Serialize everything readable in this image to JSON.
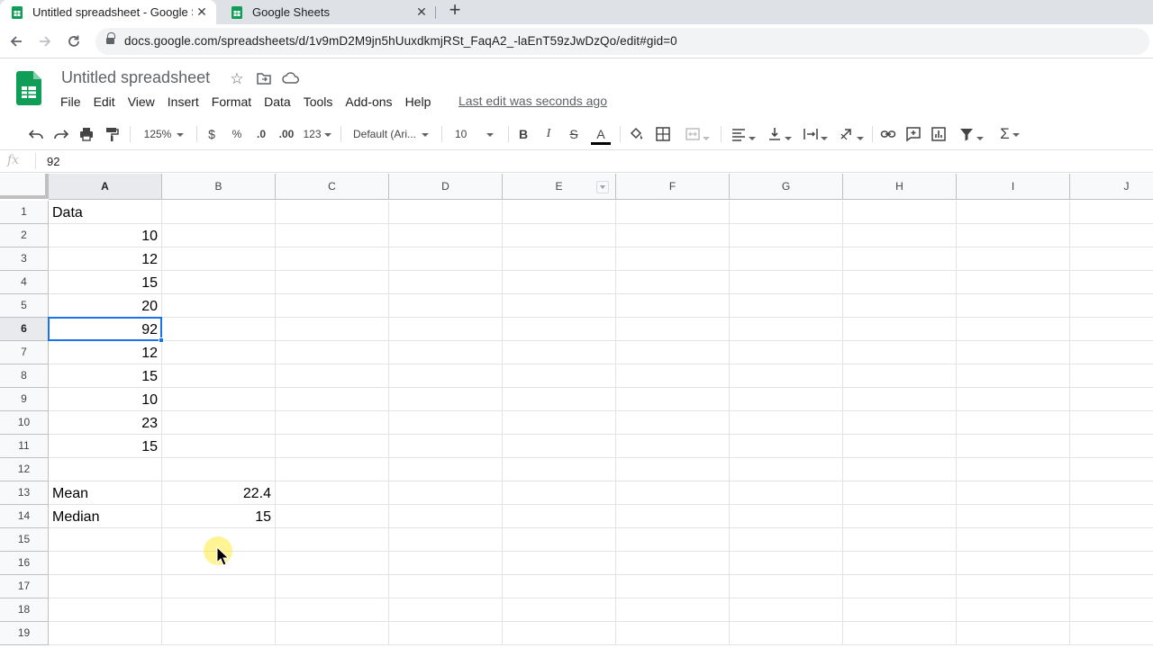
{
  "browser": {
    "tabs": [
      {
        "label": "Untitled spreadsheet - Google Sh",
        "active": true
      },
      {
        "label": "Google Sheets",
        "active": false
      }
    ],
    "url": "docs.google.com/spreadsheets/d/1v9mD2M9jn5hUuxdkmjRSt_FaqA2_-laEnT59zJwDzQo/edit#gid=0"
  },
  "app": {
    "title": "Untitled spreadsheet",
    "menu": [
      "File",
      "Edit",
      "View",
      "Insert",
      "Format",
      "Data",
      "Tools",
      "Add-ons",
      "Help"
    ],
    "last_edit": "Last edit was seconds ago",
    "brand_color": "#0f9d58"
  },
  "toolbar": {
    "zoom": "125%",
    "currency": "$",
    "percent": "%",
    "dec_decrease": ".0",
    "dec_increase": ".00",
    "more_formats": "123",
    "font": "Default (Ari...",
    "font_size": "10",
    "bold": "B",
    "italic": "I",
    "strike": "S",
    "text_color": "A"
  },
  "formula_bar": {
    "fx": "fx",
    "value": "92"
  },
  "sheet": {
    "columns": [
      "A",
      "B",
      "C",
      "D",
      "E",
      "F",
      "G",
      "H",
      "I",
      "J"
    ],
    "rows": [
      "1",
      "2",
      "3",
      "4",
      "5",
      "6",
      "7",
      "8",
      "9",
      "10",
      "11",
      "12",
      "13",
      "14",
      "15",
      "16",
      "17",
      "18",
      "19"
    ],
    "cells": {
      "A1": "Data",
      "A2": "10",
      "A3": "12",
      "A4": "15",
      "A5": "20",
      "A6": "92",
      "A7": "12",
      "A8": "15",
      "A9": "10",
      "A10": "23",
      "A11": "15",
      "A13": "Mean",
      "B13": "22.4",
      "A14": "Median",
      "B14": "15"
    },
    "selected_cell": "A6",
    "selection_color": "#1a73e8"
  }
}
